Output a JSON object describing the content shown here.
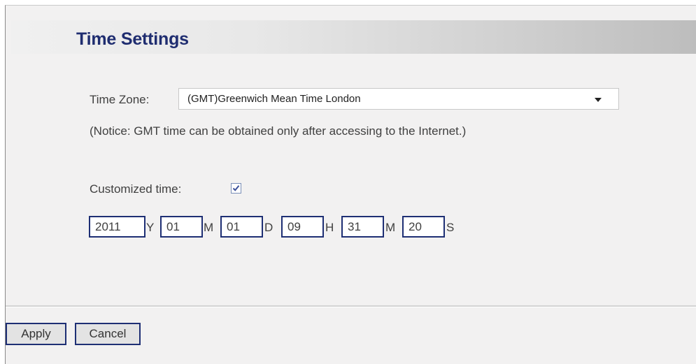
{
  "page": {
    "title": "Time Settings"
  },
  "time_zone": {
    "label": "Time Zone:",
    "selected": "(GMT)Greenwich Mean Time London",
    "notice": "(Notice: GMT time can be obtained only after accessing to the Internet.)"
  },
  "customized_time": {
    "label": "Customized time:",
    "checked": true,
    "fields": [
      {
        "value": "2011",
        "unit": "Y"
      },
      {
        "value": "01",
        "unit": "M"
      },
      {
        "value": "01",
        "unit": "D"
      },
      {
        "value": "09",
        "unit": "H"
      },
      {
        "value": "31",
        "unit": "M"
      },
      {
        "value": "20",
        "unit": "S"
      }
    ]
  },
  "buttons": {
    "apply": "Apply",
    "cancel": "Cancel"
  },
  "colors": {
    "title": "#1f2d70",
    "input_border": "#1e2f74",
    "panel_bg": "#f2f1f1",
    "text": "#404040"
  },
  "icons": {
    "dropdown": "chevron-down-icon",
    "check": "checkmark-icon"
  }
}
